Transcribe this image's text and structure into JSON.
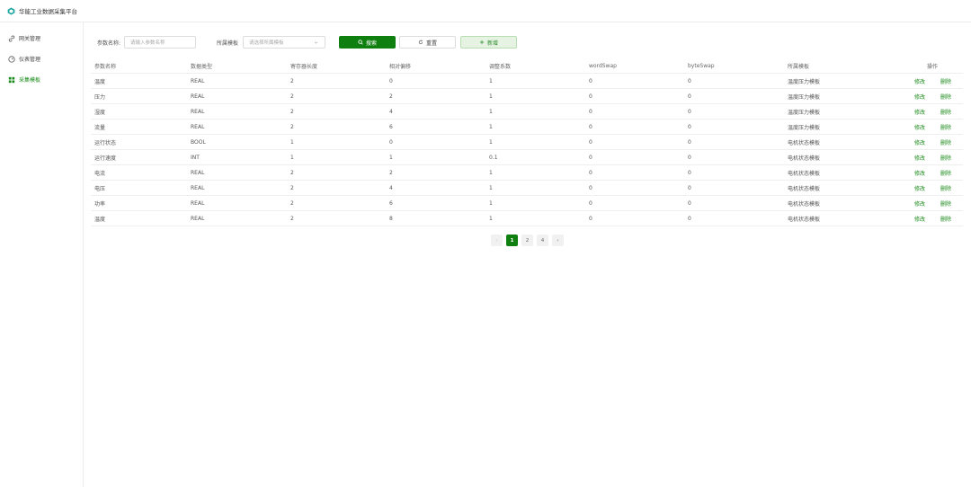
{
  "app": {
    "title": "华能工业数据采集平台"
  },
  "sidebar": {
    "items": [
      {
        "label": "网关管理",
        "icon": "link-icon",
        "active": false
      },
      {
        "label": "仪表管理",
        "icon": "gauge-icon",
        "active": false
      },
      {
        "label": "采集模板",
        "icon": "grid-icon",
        "active": true
      }
    ]
  },
  "filters": {
    "param_name_label": "参数名称:",
    "param_name_placeholder": "请输入参数名称",
    "template_label": "所属模板",
    "template_placeholder": "请选择所属模板",
    "search_label": "搜索",
    "reset_label": "重置",
    "add_label": "新增"
  },
  "table": {
    "headers": [
      "参数名称",
      "数据类型",
      "寄存器长度",
      "相对偏移",
      "调整系数",
      "wordSwap",
      "byteSwap",
      "所属模板",
      "操作"
    ],
    "rows": [
      [
        "温度",
        "REAL",
        "2",
        "0",
        "1",
        "0",
        "0",
        "温度压力模板"
      ],
      [
        "压力",
        "REAL",
        "2",
        "2",
        "1",
        "0",
        "0",
        "温度压力模板"
      ],
      [
        "湿度",
        "REAL",
        "2",
        "4",
        "1",
        "0",
        "0",
        "温度压力模板"
      ],
      [
        "流量",
        "REAL",
        "2",
        "6",
        "1",
        "0",
        "0",
        "温度压力模板"
      ],
      [
        "运行状态",
        "BOOL",
        "1",
        "0",
        "1",
        "0",
        "0",
        "电机状态模板"
      ],
      [
        "运行速度",
        "INT",
        "1",
        "1",
        "0.1",
        "0",
        "0",
        "电机状态模板"
      ],
      [
        "电流",
        "REAL",
        "2",
        "2",
        "1",
        "0",
        "0",
        "电机状态模板"
      ],
      [
        "电压",
        "REAL",
        "2",
        "4",
        "1",
        "0",
        "0",
        "电机状态模板"
      ],
      [
        "功率",
        "REAL",
        "2",
        "6",
        "1",
        "0",
        "0",
        "电机状态模板"
      ],
      [
        "温度",
        "REAL",
        "2",
        "8",
        "1",
        "0",
        "0",
        "电机状态模板"
      ]
    ],
    "edit_label": "修改",
    "delete_label": "删除"
  },
  "pagination": {
    "prev": "‹",
    "pages": [
      "1",
      "2",
      "4"
    ],
    "current": "1",
    "next": "›"
  },
  "colors": {
    "accent": "#0f7f10",
    "add_bg": "#e6f3e2"
  }
}
